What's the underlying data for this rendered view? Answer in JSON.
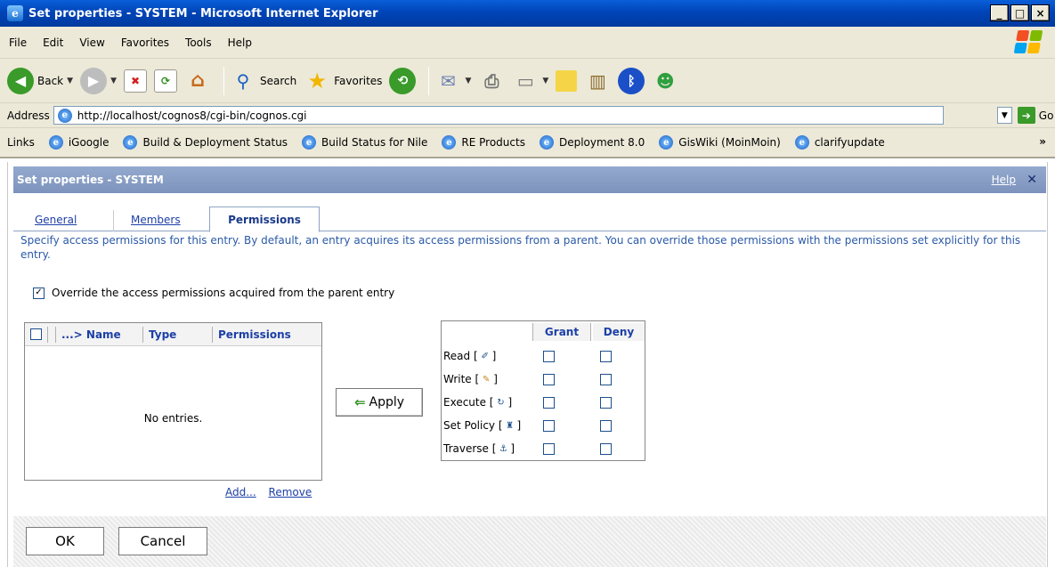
{
  "window": {
    "title": "Set properties - SYSTEM - Microsoft Internet Explorer",
    "minimize": "_",
    "maximize": "□",
    "close": "×"
  },
  "menu": [
    "File",
    "Edit",
    "View",
    "Favorites",
    "Tools",
    "Help"
  ],
  "toolbar": {
    "back": "Back",
    "search": "Search",
    "favorites": "Favorites"
  },
  "address": {
    "label": "Address",
    "url": "http://localhost/cognos8/cgi-bin/cognos.cgi",
    "go": "Go"
  },
  "links": {
    "label": "Links",
    "items": [
      "iGoogle",
      "Build & Deployment Status",
      "Build Status for Nile",
      "RE Products",
      "Deployment 8.0",
      "GisWiki (MoinMoin)",
      "clarifyupdate"
    ],
    "more": "»"
  },
  "dialog": {
    "title": "Set properties - SYSTEM",
    "help": "Help",
    "close": "✕",
    "tabs": [
      "General",
      "Members",
      "Permissions"
    ],
    "active_tab": "Permissions",
    "description": "Specify access permissions for this entry. By default, an entry acquires its access permissions from a parent. You can override those permissions with the permissions set explicitly for this entry.",
    "override_label": "Override the access permissions acquired from the parent entry",
    "override_checked": "✓",
    "entries": {
      "col_name": "...> Name",
      "col_type": "Type",
      "col_permissions": "Permissions",
      "empty": "No entries."
    },
    "add": "Add...",
    "remove": "Remove",
    "apply": "Apply",
    "apply_arrow": "⇐",
    "permissions": {
      "grant": "Grant",
      "deny": "Deny",
      "rows": [
        {
          "label": "Read [",
          "icon": "✐",
          "end": "]"
        },
        {
          "label": "Write [",
          "icon": "✎",
          "end": "]"
        },
        {
          "label": "Execute [",
          "icon": "↻",
          "end": "]"
        },
        {
          "label": "Set Policy [",
          "icon": "♜",
          "end": "]"
        },
        {
          "label": "Traverse [",
          "icon": "⚓",
          "end": "]"
        }
      ]
    },
    "ok": "OK",
    "cancel": "Cancel"
  },
  "colors": {
    "titlebar": "#0044b8",
    "dialog_header": "#7d93bd",
    "link_blue": "#1c3fa6",
    "description_blue": "#2a59a8"
  }
}
